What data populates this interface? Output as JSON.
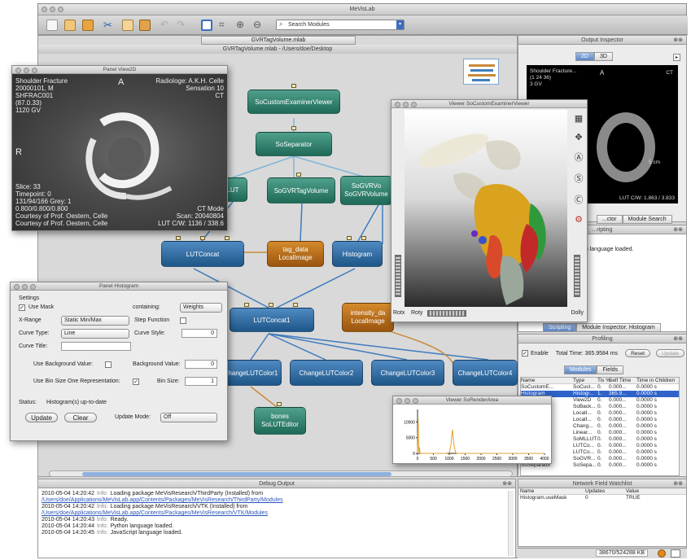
{
  "app_title": "MeVisLab",
  "toolbar": {
    "search_placeholder": "Search Modules",
    "icons": [
      "new-icon",
      "open-icon",
      "save-icon",
      "cut-icon",
      "copy-icon",
      "paste-icon",
      "undo-icon",
      "redo-icon",
      "fit-icon",
      "zoom-fit-icon",
      "zoom-in-icon",
      "zoom-out-icon"
    ]
  },
  "network": {
    "tab_label": "GVRTagVolume.mlab",
    "title": "GVRTagVolume.mlab - /Users/doe/Desktop",
    "nodes": {
      "examiner": "SoCustomExaminerViewer",
      "separator": "SoSeparator",
      "lut_partial": "LUT",
      "gvrtag": "SoGVRTagVolume",
      "gvrvol1": "SoGVRVo",
      "gvrvol2": "SoGVRVolume",
      "lutconcat": "LUTConcat",
      "tagdata1": "tag_data",
      "tagdata2": "LocalImage",
      "histogram": "Histogram",
      "lutconcat1": "LUTConcat1",
      "intensity1": "intensity_da",
      "intensity2": "LocalImage",
      "clut1": "ChangeLUTColor1",
      "clut2": "ChangeLUTColor2",
      "clut3": "ChangeLUTColor3",
      "clut4": "ChangeLUTColor4",
      "bones1": "bones",
      "bones2": "SoLUTEditor"
    }
  },
  "panel_view2d": {
    "title": "Panel View2D",
    "tl": [
      "Shoulder Fracture",
      "20000101, M",
      "SHFRAC001",
      "(87.0.33)",
      "1120 GV"
    ],
    "tr": [
      "Radiologe: A.K.H. Celle",
      "Sensation 10",
      "CT"
    ],
    "label_A": "A",
    "label_R": "R",
    "bl": [
      "Slice: 33",
      "Timepoint: 0",
      "131/94/166 Grey: 1",
      "0.800/0.800/0.800",
      "Courtesy of Prof. Oestern, Celle",
      "Courtesy of Prof. Oestern, Celle"
    ],
    "br": [
      "CT Mode",
      "Scan: 20040804",
      "LUT C/W: 1136 / 338.6"
    ]
  },
  "viewer_3d": {
    "title": "Viewer SoCustomExaminerViewer",
    "rotx": "Rotx",
    "roty": "Roty",
    "dolly": "Dolly"
  },
  "output_inspector": {
    "title": "Output Inspector",
    "tab_2d": "2D",
    "tab_3d": "3D",
    "overlay_tl": [
      "Shoulder Fracture...",
      "(1 24 36)",
      "3 GV"
    ],
    "overlay_a": "A",
    "overlay_ct": "CT",
    "overlay_scale": "5 cm",
    "overlay_lut": "LUT C/W: 1.863 / 3.833",
    "tabs": [
      "...ctor",
      "Module Search"
    ]
  },
  "scripting": {
    "title": "...ripting",
    "text": "Python language loaded.",
    "tabs": [
      "Scripting",
      "Module Inspector: Histogram"
    ]
  },
  "profiling": {
    "title": "Profiling",
    "enable_label": "Enable",
    "total_time": "Total Time: 365.9584 ms",
    "reset": "Reset",
    "update": "Update",
    "tabs": [
      "Modules",
      "Fields"
    ],
    "columns": [
      "Name",
      "Type",
      "Tis %",
      "Self Time",
      "Time in Children"
    ],
    "rows": [
      [
        "SoCustomE...",
        "SoCust...",
        "0.",
        "0.000...",
        "0.0000 s"
      ],
      [
        "Histogram",
        "Histogr...",
        "1.",
        "365.9...",
        "0.0000 s"
      ],
      [
        "",
        "View2D",
        "0.",
        "0.000...",
        "0.0000 s"
      ],
      [
        "",
        "SoBack...",
        "0.",
        "0.000...",
        "0.0000 s"
      ],
      [
        "",
        "LocalI...",
        "0.",
        "0.000...",
        "0.0000 s"
      ],
      [
        "",
        "LocalI...",
        "0.",
        "0.000...",
        "0.0000 s"
      ],
      [
        "",
        "Chang...",
        "0.",
        "0.000...",
        "0.0000 s"
      ],
      [
        "",
        "Linear...",
        "0.",
        "0.000...",
        "0.0000 s"
      ],
      [
        "",
        "SoMLLUT",
        "0.",
        "0.000...",
        "0.0000 s"
      ],
      [
        "",
        "LUTCo...",
        "0.",
        "0.000...",
        "0.0000 s"
      ],
      [
        "",
        "LUTCo...",
        "0.",
        "0.000...",
        "0.0000 s"
      ],
      [
        "",
        "SoGVR...",
        "0.",
        "0.000...",
        "0.0000 s"
      ],
      [
        "SoSeparator",
        "SoSepa...",
        "0.",
        "0.000...",
        "0.0000 s"
      ]
    ]
  },
  "panel_histogram": {
    "title": "Panel Histogram",
    "section": "Settings",
    "use_mask": "Use Mask",
    "containing_label": "containing:",
    "containing_value": "Weights",
    "xrange_label": "X-Range",
    "xrange_value": "Static Min/Max",
    "step_function": "Step Function",
    "curve_type_label": "Curve Type:",
    "curve_type_value": "Line",
    "curve_style_label": "Curve Style:",
    "curve_style_value": "0",
    "curve_title_label": "Curve Title:",
    "use_bg_label": "Use Background Value:",
    "bg_value_label": "Background Value:",
    "bg_value": "0",
    "use_bin_label": "Use Bin Size One Representation:",
    "bin_size_label": "Bin Size:",
    "bin_size": "1",
    "status_label": "Status:",
    "status_value": "Histogram(s) up-to-date",
    "update_btn": "Update",
    "clear_btn": "Clear",
    "update_mode_label": "Update Mode:",
    "update_mode_value": "Off"
  },
  "viewer_area": {
    "title": "Viewer SoRenderArea"
  },
  "chart_data": {
    "type": "line",
    "x_ticks": [
      "0",
      "500",
      "1000",
      "1500",
      "2000",
      "2500",
      "3000",
      "3500",
      "4000"
    ],
    "y_ticks": [
      "0",
      "5000",
      "10000"
    ],
    "xlim": [
      0,
      4000
    ],
    "ylim": [
      0,
      14000
    ],
    "x": [
      0,
      20,
      40,
      60,
      80,
      100,
      400,
      900,
      1000,
      1050,
      1100,
      1150,
      1200,
      1250,
      1400,
      4000
    ],
    "y": [
      0,
      11000,
      300,
      2000,
      100,
      0,
      0,
      0,
      200,
      2500,
      7600,
      2500,
      200,
      0,
      0,
      0
    ],
    "color": "#e3a030"
  },
  "debug": {
    "title": "Debug Output",
    "lines": [
      {
        "ts": "2010-05-04 14:20:42",
        "lvl": "Info:",
        "text": "Loading package MeVisResearch/ThirdParty (Installed) from"
      },
      {
        "link": "/Users/doe/Applications/MeVisLab.app/Contents/Packages/MeVisResearch/ThirdParty/Modules"
      },
      {
        "ts": "2010-05-04 14:20:42",
        "lvl": "Info:",
        "text": "Loading package MeVisResearch/VTK (Installed) from"
      },
      {
        "link": "/Users/doe/Applications/MeVisLab.app/Contents/Packages/MeVisResearch/VTK/Modules"
      },
      {
        "ts": "2010-05-04 14:20:43",
        "lvl": "Info:",
        "text": "Ready."
      },
      {
        "ts": "2010-05-04 14:20:44",
        "lvl": "Info:",
        "text": "Python language loaded."
      },
      {
        "ts": "2010-05-04 14:20:45",
        "lvl": "Info:",
        "text": "JavaScript language loaded."
      }
    ]
  },
  "watchlist": {
    "title": "Network Field Watchlist",
    "columns": [
      "Name",
      "Updates",
      "Value"
    ],
    "rows": [
      [
        "Histogram.useMask",
        "0",
        "TRUE"
      ]
    ]
  },
  "statusbar": {
    "memory": "38670/524288 KB"
  }
}
